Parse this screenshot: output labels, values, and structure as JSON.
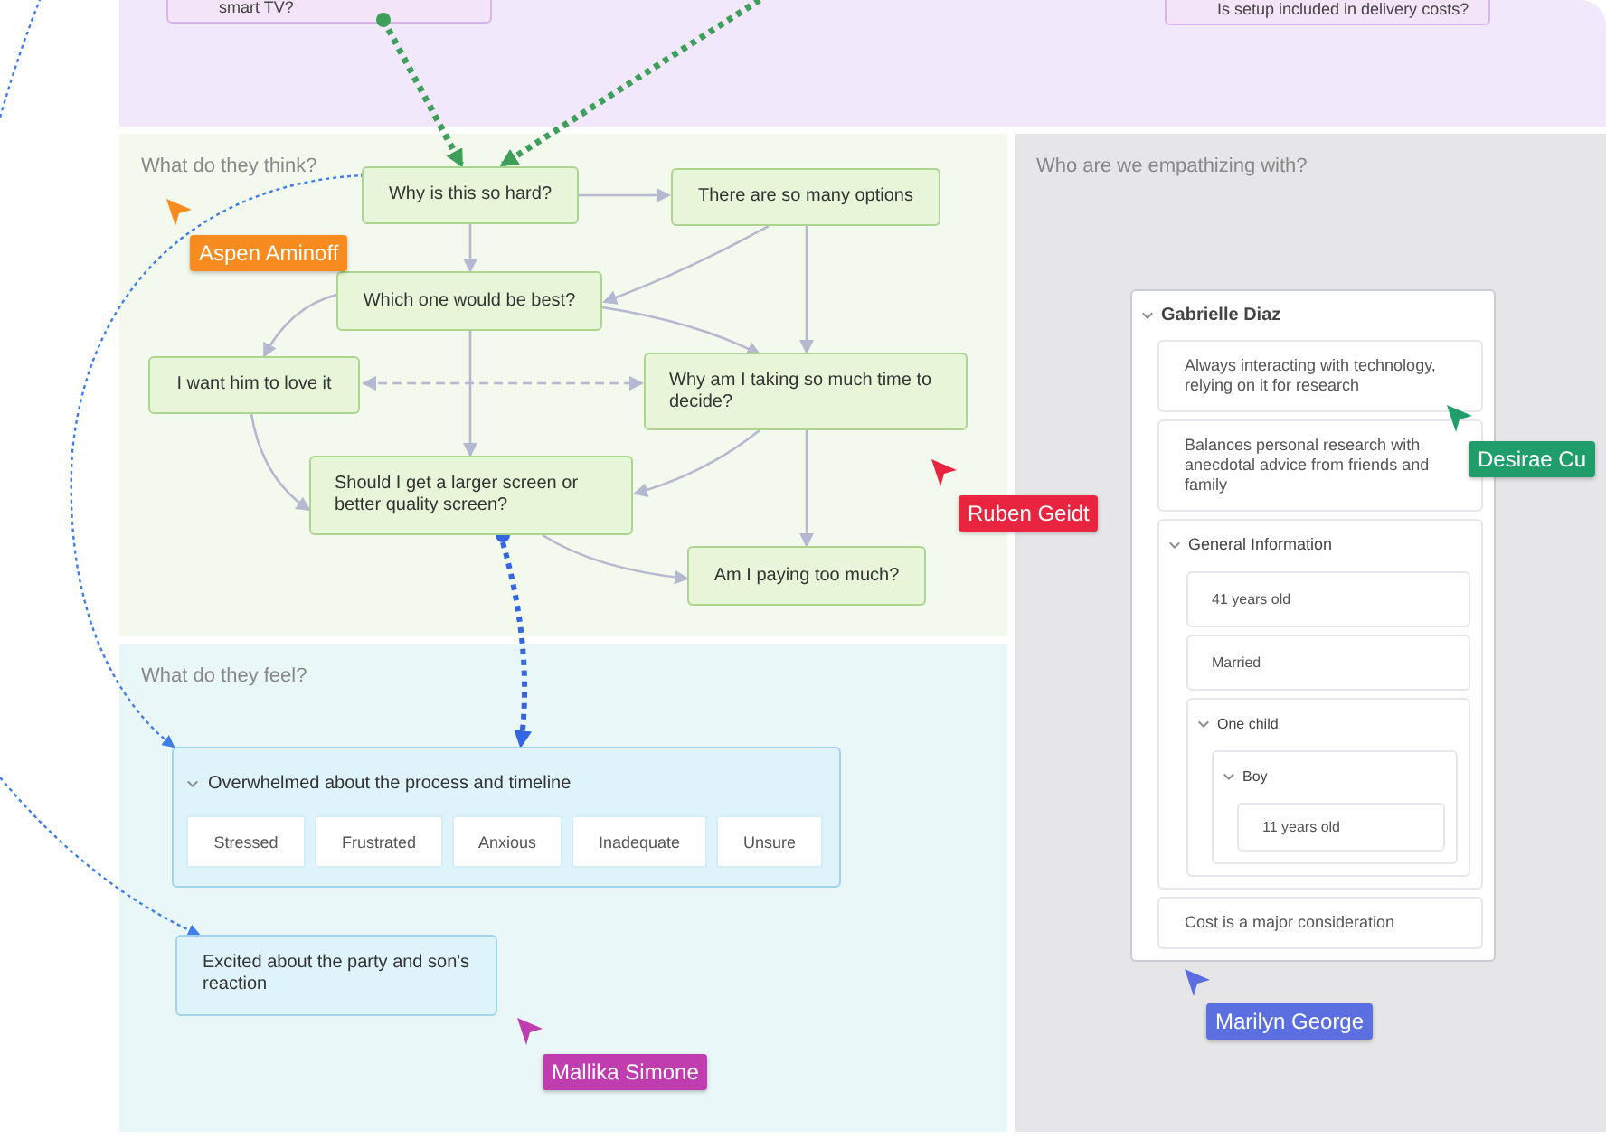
{
  "top_notes": [
    {
      "text": "smart TV?"
    },
    {
      "text": "Is setup included in delivery costs?"
    }
  ],
  "think": {
    "title": "What do they think?",
    "nodes": [
      {
        "text": "Why is this so hard?"
      },
      {
        "text": "There are so many options"
      },
      {
        "text": "Which one would be best?"
      },
      {
        "text": "I want him to love it"
      },
      {
        "text": "Why am I taking so much time to decide?"
      },
      {
        "text": "Should I get a larger screen or better quality screen?"
      },
      {
        "text": "Am I paying too much?"
      }
    ]
  },
  "feel": {
    "title": "What do they feel?",
    "group": {
      "title": "Overwhelmed about the process and timeline",
      "expanded": true,
      "tags": [
        "Stressed",
        "Frustrated",
        "Anxious",
        "Inadequate",
        "Unsure"
      ]
    },
    "notes": [
      {
        "text": "Excited about the party and son's reaction"
      }
    ]
  },
  "empathy": {
    "title": "Who are we empathizing with?",
    "persona": {
      "name": "Gabrielle Diaz",
      "expanded": true,
      "items": [
        {
          "kind": "note",
          "text": "Always interacting with technology, relying on it for research"
        },
        {
          "kind": "note",
          "text": "Balances personal research with anecdotal advice from friends and family"
        },
        {
          "kind": "group",
          "text": "General Information",
          "expanded": true,
          "children": [
            {
              "kind": "note",
              "text": "41 years old"
            },
            {
              "kind": "note",
              "text": "Married"
            },
            {
              "kind": "group",
              "text": "One child",
              "expanded": true,
              "children": [
                {
                  "kind": "group",
                  "text": "Boy",
                  "expanded": true,
                  "children": [
                    {
                      "kind": "note",
                      "text": "11 years old"
                    }
                  ]
                }
              ]
            }
          ]
        },
        {
          "kind": "note",
          "text": "Cost is a major consideration"
        }
      ]
    }
  },
  "cursors": [
    {
      "name": "Aspen Aminoff",
      "color": "#f78b1f"
    },
    {
      "name": "Ruben Geidt",
      "color": "#e8243f"
    },
    {
      "name": "Desirae Cu",
      "color": "#1f9e6b"
    },
    {
      "name": "Marilyn George",
      "color": "#5b6fe0"
    },
    {
      "name": "Mallika Simone",
      "color": "#c03db0"
    }
  ]
}
